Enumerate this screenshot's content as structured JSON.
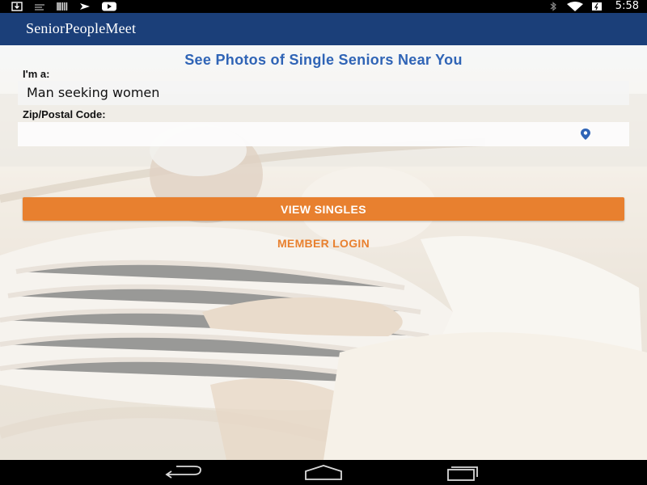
{
  "status_bar": {
    "time": "5:58",
    "left_icons": [
      "download-icon",
      "notification-icon",
      "barcode-icon",
      "flight-icon",
      "youtube-icon"
    ],
    "right_icons": [
      "bluetooth-icon",
      "wifi-icon",
      "battery-icon"
    ]
  },
  "app_bar": {
    "logo": "SeniorPeopleMeet"
  },
  "form": {
    "headline": "See Photos of Single Seniors Near You",
    "gender_label": "I'm a:",
    "gender_value": "Man seeking women",
    "zip_label": "Zip/Postal Code:",
    "zip_value": "",
    "location_icon": "location-pin-icon",
    "view_button": "VIEW SINGLES",
    "login_link": "MEMBER LOGIN"
  },
  "nav_bar": {
    "icons": [
      "back-icon",
      "home-icon",
      "recent-apps-icon"
    ]
  },
  "colors": {
    "app_bar": "#1b3f79",
    "headline": "#2f64b6",
    "accent": "#e8802f"
  }
}
